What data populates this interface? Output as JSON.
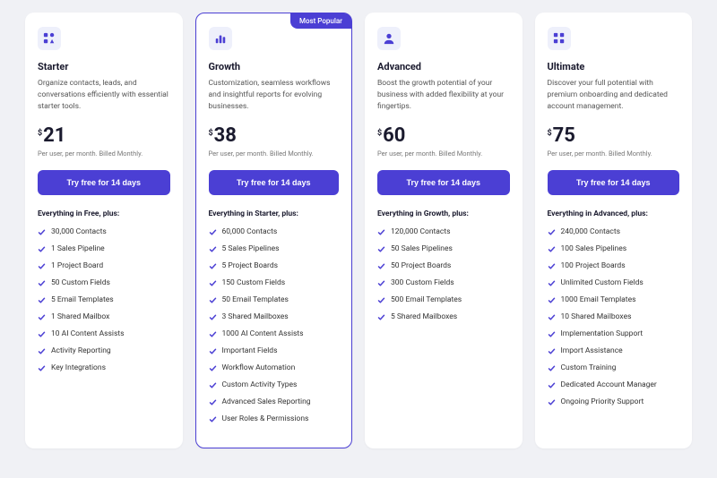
{
  "badge_text": "Most Popular",
  "currency_symbol": "$",
  "cta_label": "Try free for 14 days",
  "billing_note": "Per user, per month. Billed Monthly.",
  "plans": [
    {
      "icon": "shapes-icon",
      "name": "Starter",
      "desc": "Organize contacts, leads, and conversations efficiently with essential starter tools.",
      "price": "21",
      "feat_head": "Everything in Free, plus:",
      "features": [
        "30,000 Contacts",
        "1 Sales Pipeline",
        "1 Project Board",
        "50 Custom Fields",
        "5 Email Templates",
        "1 Shared Mailbox",
        "10 AI Content Assists",
        "Activity Reporting",
        "Key Integrations"
      ],
      "highlight": false
    },
    {
      "icon": "bars-icon",
      "name": "Growth",
      "desc": "Customization, seamless workflows and insightful reports for evolving businesses.",
      "price": "38",
      "feat_head": "Everything in Starter, plus:",
      "features": [
        "60,000 Contacts",
        "5 Sales Pipelines",
        "5 Project Boards",
        "150 Custom Fields",
        "50 Email Templates",
        "3 Shared Mailboxes",
        "1000 AI Content Assists",
        "Important Fields",
        "Workflow Automation",
        "Custom Activity Types",
        "Advanced Sales Reporting",
        "User Roles & Permissions"
      ],
      "highlight": true
    },
    {
      "icon": "user-icon",
      "name": "Advanced",
      "desc": "Boost the growth potential of your business with added flexibility at your fingertips.",
      "price": "60",
      "feat_head": "Everything in Growth, plus:",
      "features": [
        "120,000 Contacts",
        "50 Sales Pipelines",
        "50 Project Boards",
        "300 Custom Fields",
        "500 Email Templates",
        "5 Shared Mailboxes"
      ],
      "highlight": false
    },
    {
      "icon": "grid-icon",
      "name": "Ultimate",
      "desc": "Discover your full potential with premium onboarding and dedicated account management.",
      "price": "75",
      "feat_head": "Everything in Advanced, plus:",
      "features": [
        "240,000 Contacts",
        "100 Sales Pipelines",
        "100 Project Boards",
        "Unlimited Custom Fields",
        "1000 Email Templates",
        "10 Shared Mailboxes",
        "Implementation Support",
        "Import Assistance",
        "Custom Training",
        "Dedicated Account Manager",
        "Ongoing Priority Support"
      ],
      "highlight": false
    }
  ]
}
